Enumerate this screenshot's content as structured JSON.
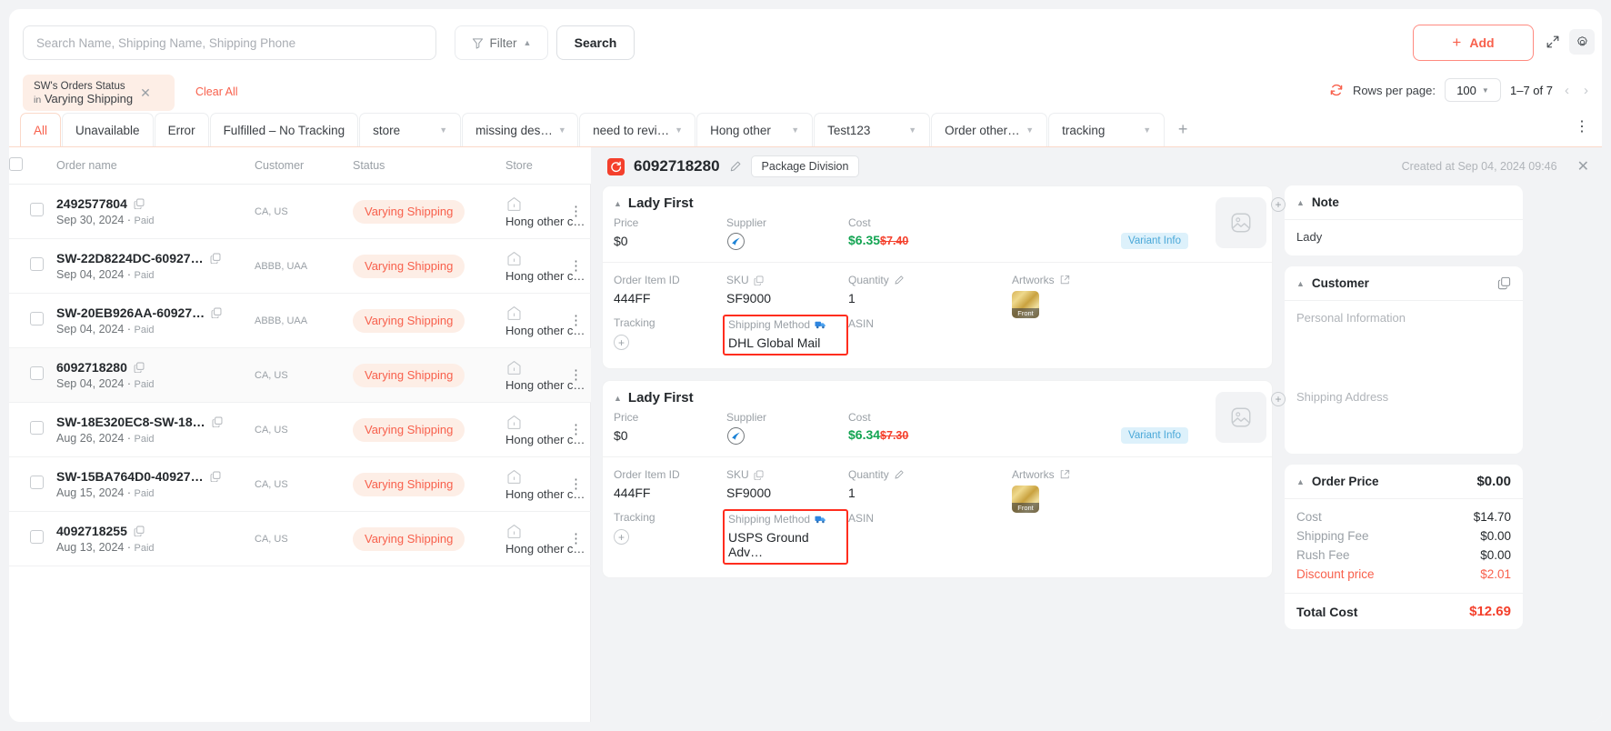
{
  "toolbar": {
    "search_placeholder": "Search Name, Shipping Name, Shipping Phone",
    "search_value": "",
    "filter_label": "Filter",
    "search_label": "Search",
    "add_label": "Add",
    "add_plus": "+",
    "expand_icon": "expand-icon",
    "gear_icon": "gear-icon"
  },
  "filter_chip": {
    "line1": "SW's Orders Status",
    "line2_prefix": "in",
    "line2": "Varying Shipping",
    "close": "✕",
    "clear_all": "Clear All"
  },
  "pagination": {
    "refresh_icon": "refresh-icon",
    "rows_per_page_label": "Rows per page:",
    "rows_per_page_value": "100",
    "range": "1–7 of 7",
    "prev": "‹",
    "next": "›"
  },
  "tabs": [
    {
      "label": "All",
      "active": true,
      "dropdown": false
    },
    {
      "label": "Unavailable",
      "active": false,
      "dropdown": false
    },
    {
      "label": "Error",
      "active": false,
      "dropdown": false
    },
    {
      "label": "Fulfilled – No Tracking",
      "active": false,
      "dropdown": false
    },
    {
      "label": "store",
      "active": false,
      "dropdown": true
    },
    {
      "label": "missing des…",
      "active": false,
      "dropdown": true
    },
    {
      "label": "need to revi…",
      "active": false,
      "dropdown": true
    },
    {
      "label": "Hong other",
      "active": false,
      "dropdown": true
    },
    {
      "label": "Test123",
      "active": false,
      "dropdown": true
    },
    {
      "label": "Order other…",
      "active": false,
      "dropdown": true
    },
    {
      "label": "tracking",
      "active": false,
      "dropdown": true
    }
  ],
  "tab_add": "+",
  "tab_more": "⋮",
  "table": {
    "columns": [
      "Order name",
      "Customer",
      "Status",
      "Store"
    ],
    "rows": [
      {
        "name": "2492577804",
        "date": "Sep 30, 2024",
        "paid": "Paid",
        "customer": "CA, US",
        "status": "Varying Shipping",
        "store": "Hong other c…",
        "selected": false
      },
      {
        "name": "SW-22D8224DC-60927…",
        "date": "Sep 04, 2024",
        "paid": "Paid",
        "customer": "ABBB, UAA",
        "status": "Varying Shipping",
        "store": "Hong other c…",
        "selected": false
      },
      {
        "name": "SW-20EB926AA-60927…",
        "date": "Sep 04, 2024",
        "paid": "Paid",
        "customer": "ABBB, UAA",
        "status": "Varying Shipping",
        "store": "Hong other c…",
        "selected": false
      },
      {
        "name": "6092718280",
        "date": "Sep 04, 2024",
        "paid": "Paid",
        "customer": "CA, US",
        "status": "Varying Shipping",
        "store": "Hong other c…",
        "selected": true
      },
      {
        "name": "SW-18E320EC8-SW-18…",
        "date": "Aug 26, 2024",
        "paid": "Paid",
        "customer": "CA, US",
        "status": "Varying Shipping",
        "store": "Hong other c…",
        "selected": false
      },
      {
        "name": "SW-15BA764D0-40927…",
        "date": "Aug 15, 2024",
        "paid": "Paid",
        "customer": "CA, US",
        "status": "Varying Shipping",
        "store": "Hong other c…",
        "selected": false
      },
      {
        "name": "4092718255",
        "date": "Aug 13, 2024",
        "paid": "Paid",
        "customer": "CA, US",
        "status": "Varying Shipping",
        "store": "Hong other c…",
        "selected": false
      }
    ]
  },
  "detail": {
    "order_id": "6092718280",
    "package_division": "Package Division",
    "created_at": "Created at Sep 04, 2024 09:46",
    "close": "✕",
    "items": [
      {
        "title": "Lady First",
        "price_label": "Price",
        "price_value": "$0",
        "supplier_label": "Supplier",
        "cost_label": "Cost",
        "cost_now": "$6.35",
        "cost_was": "$7.40",
        "variant_info": "Variant Info",
        "order_item_id_label": "Order Item ID",
        "order_item_id": "444FF",
        "sku_label": "SKU",
        "sku": "SF9000",
        "quantity_label": "Quantity",
        "quantity": "1",
        "artworks_label": "Artworks",
        "artwork_thumb_label": "Front",
        "tracking_label": "Tracking",
        "shipping_method_label": "Shipping Method",
        "shipping_method": "DHL Global Mail",
        "asin_label": "ASIN",
        "asin": ""
      },
      {
        "title": "Lady First",
        "price_label": "Price",
        "price_value": "$0",
        "supplier_label": "Supplier",
        "cost_label": "Cost",
        "cost_now": "$6.34",
        "cost_was": "$7.30",
        "variant_info": "Variant Info",
        "order_item_id_label": "Order Item ID",
        "order_item_id": "444FF",
        "sku_label": "SKU",
        "sku": "SF9000",
        "quantity_label": "Quantity",
        "quantity": "1",
        "artworks_label": "Artworks",
        "artwork_thumb_label": "Front",
        "tracking_label": "Tracking",
        "shipping_method_label": "Shipping Method",
        "shipping_method": "USPS Ground Adv…",
        "asin_label": "ASIN",
        "asin": ""
      }
    ]
  },
  "side": {
    "note": {
      "title": "Note",
      "value": "Lady"
    },
    "customer": {
      "title": "Customer",
      "personal_information": "Personal Information",
      "shipping_address": "Shipping Address"
    },
    "order_price": {
      "title": "Order Price",
      "amount": "$0.00",
      "lines": [
        {
          "label": "Cost",
          "value": "$14.70",
          "discount": false
        },
        {
          "label": "Shipping Fee",
          "value": "$0.00",
          "discount": false
        },
        {
          "label": "Rush Fee",
          "value": "$0.00",
          "discount": false
        },
        {
          "label": "Discount price",
          "value": "$2.01",
          "discount": true
        }
      ],
      "total_label": "Total Cost",
      "total_value": "$12.69"
    }
  },
  "colors": {
    "accent": "#f8604c",
    "badge_bg": "#fdeee6",
    "green": "#13a452",
    "red": "#f4402c",
    "highlight_border": "#ff2d1e"
  }
}
